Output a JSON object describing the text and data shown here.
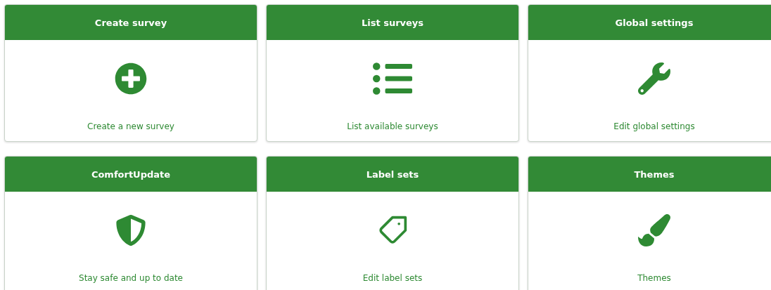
{
  "cards": [
    {
      "title": "Create survey",
      "description": "Create a new survey"
    },
    {
      "title": "List surveys",
      "description": "List available surveys"
    },
    {
      "title": "Global settings",
      "description": "Edit global settings"
    },
    {
      "title": "ComfortUpdate",
      "description": "Stay safe and up to date"
    },
    {
      "title": "Label sets",
      "description": "Edit label sets"
    },
    {
      "title": "Themes",
      "description": "Themes"
    }
  ]
}
